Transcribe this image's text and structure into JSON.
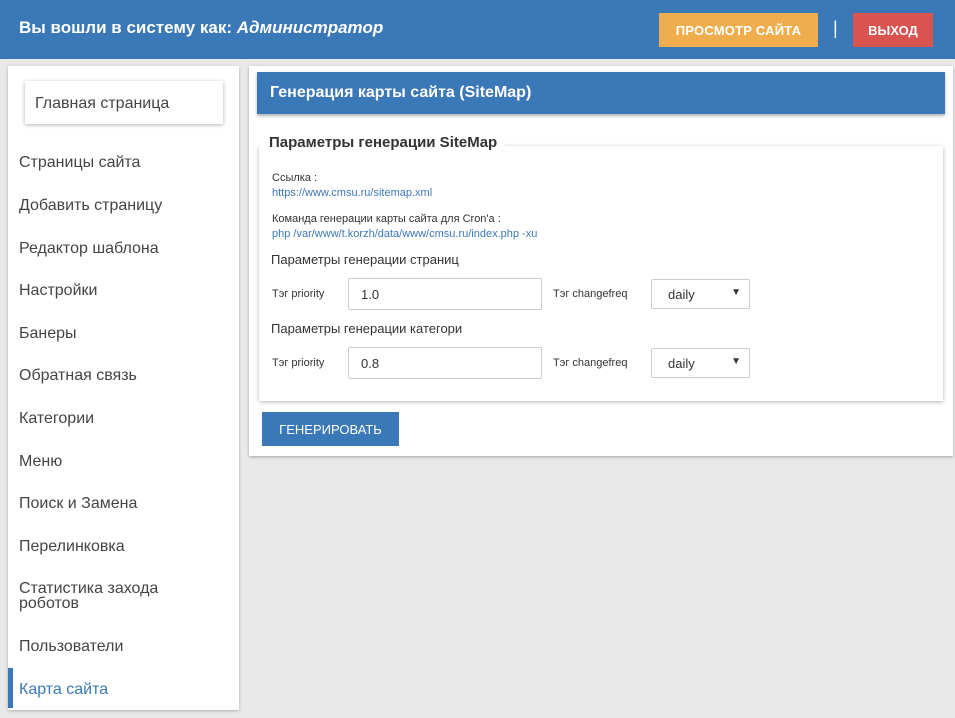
{
  "header": {
    "login_prefix": "Вы вошли в систему как: ",
    "role": "Администратор",
    "view_site_label": "ПРОСМОТР САЙТА",
    "separator": "|",
    "exit_label": "ВЫХОД"
  },
  "sidebar": {
    "home_label": "Главная страница",
    "items": [
      {
        "label": "Страницы сайта"
      },
      {
        "label": "Добавить страницу"
      },
      {
        "label": "Редактор шаблона"
      },
      {
        "label": "Настройки"
      },
      {
        "label": "Банеры"
      },
      {
        "label": "Обратная связь"
      },
      {
        "label": "Категории"
      },
      {
        "label": "Меню"
      },
      {
        "label": "Поиск и Замена"
      },
      {
        "label": "Перелинковка"
      },
      {
        "label": "Статистика захода роботов"
      },
      {
        "label": "Пользователи"
      },
      {
        "label": "Карта сайта"
      }
    ],
    "active_item": "Карта сайта"
  },
  "main": {
    "title": "Генерация карты сайта (SiteMap)",
    "legend": "Параметры генерации SiteMap",
    "link_label": "Ссылка :",
    "link_url": "https://www.cmsu.ru/sitemap.xml",
    "cron_label": "Команда генерации карты сайта для Cron'a :",
    "cron_command": "php /var/www/t.korzh/data/www/cmsu.ru/index.php -xu",
    "pages_section": {
      "title": "Параметры генерации страниц",
      "priority_label": "Тэг priority",
      "priority_value": "1.0",
      "changefreq_label": "Тэг changefreq",
      "changefreq_value": "daily"
    },
    "categories_section": {
      "title": "Параметры генерации категори",
      "priority_label": "Тэг priority",
      "priority_value": "0.8",
      "changefreq_label": "Тэг changefreq",
      "changefreq_value": "daily"
    },
    "generate_label": "ГЕНЕРИРОВАТЬ"
  },
  "colors": {
    "primary": "#3a78b8",
    "warning": "#f0ad4e",
    "danger": "#d9534f",
    "background": "#e9e9e9"
  },
  "icons": {
    "select_arrow": "chevron-down-icon"
  }
}
